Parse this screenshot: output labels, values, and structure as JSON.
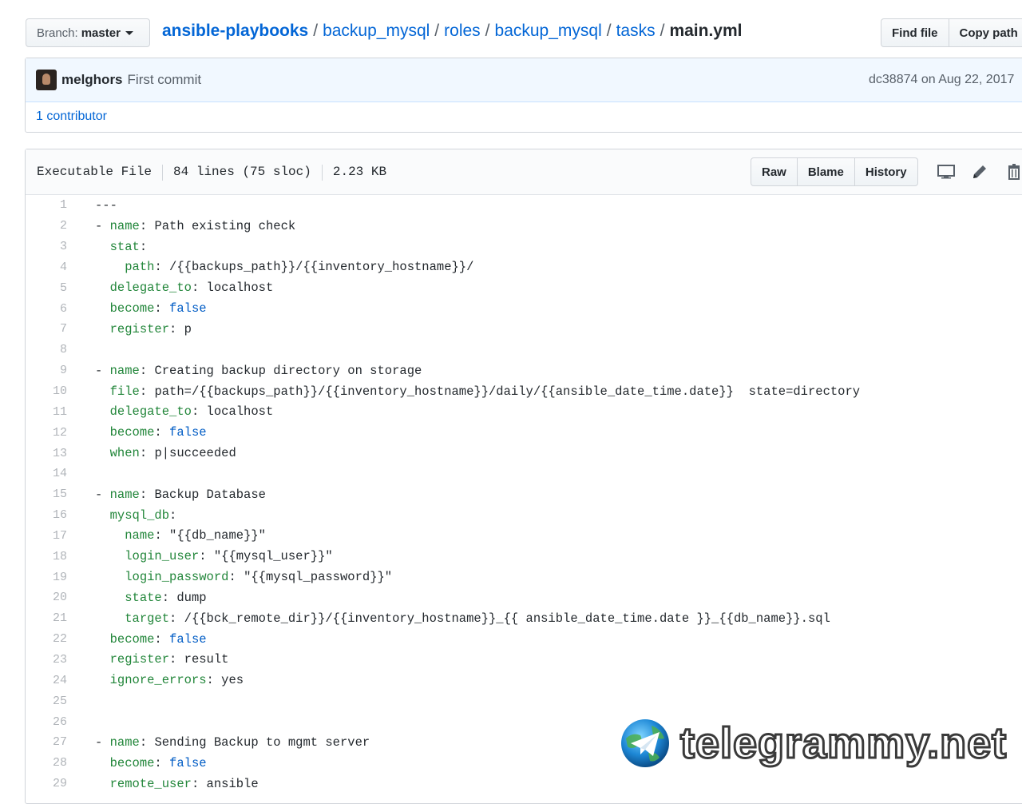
{
  "branch": {
    "label": "Branch:",
    "value": "master"
  },
  "breadcrumb": {
    "repo": "ansible-playbooks",
    "parts": [
      "backup_mysql",
      "roles",
      "backup_mysql",
      "tasks"
    ],
    "file": "main.yml",
    "separator": "/"
  },
  "header_buttons": {
    "find_file": "Find file",
    "copy_path": "Copy path"
  },
  "commit": {
    "author": "melghors",
    "message": "First commit",
    "sha_info": "dc38874 on Aug 22, 2017",
    "contributors": "1 contributor"
  },
  "file": {
    "mode": "Executable File",
    "lines": "84 lines (75 sloc)",
    "size": "2.23 KB",
    "buttons": {
      "raw": "Raw",
      "blame": "Blame",
      "history": "History"
    }
  },
  "code_lines": [
    "---",
    "- name: Path existing check",
    "  stat:",
    "    path: /{{backups_path}}/{{inventory_hostname}}/",
    "  delegate_to: localhost",
    "  become: false",
    "  register: p",
    "",
    "- name: Creating backup directory on storage",
    "  file: path=/{{backups_path}}/{{inventory_hostname}}/daily/{{ansible_date_time.date}}  state=directory",
    "  delegate_to: localhost",
    "  become: false",
    "  when: p|succeeded",
    "",
    "- name: Backup Database",
    "  mysql_db:",
    "    name: \"{{db_name}}\"",
    "    login_user: \"{{mysql_user}}\"",
    "    login_password: \"{{mysql_password}}\"",
    "    state: dump",
    "    target: /{{bck_remote_dir}}/{{inventory_hostname}}_{{ ansible_date_time.date }}_{{db_name}}.sql",
    "  become: false",
    "  register: result",
    "  ignore_errors: yes",
    "",
    "",
    "- name: Sending Backup to mgmt server",
    "  become: false",
    "  remote_user: ansible"
  ],
  "watermark": "telegrammy.net",
  "colors": {
    "link": "#0366d6",
    "yaml_key": "#22863a",
    "yaml_bool": "#005cc5"
  }
}
